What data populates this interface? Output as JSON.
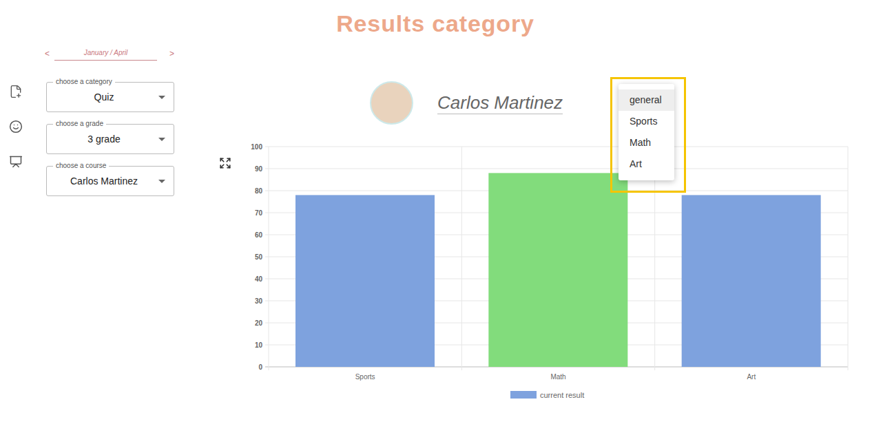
{
  "title": "Results category",
  "period": {
    "prev": "<",
    "label": "January / April",
    "next": ">"
  },
  "filters": [
    {
      "label": "choose a category",
      "value": "Quiz"
    },
    {
      "label": "choose a grade",
      "value": "3 grade"
    },
    {
      "label": "choose a course",
      "value": "Carlos Martinez"
    }
  ],
  "student": {
    "name": "Carlos Martinez"
  },
  "menu": {
    "items": [
      {
        "label": "general",
        "selected": true
      },
      {
        "label": "Sports",
        "selected": false
      },
      {
        "label": "Math",
        "selected": false
      },
      {
        "label": "Art",
        "selected": false
      }
    ]
  },
  "chart": {
    "y_ticks": [
      "0",
      "10",
      "20",
      "30",
      "40",
      "50",
      "60",
      "70",
      "80",
      "90",
      "100"
    ],
    "categories": [
      "Sports",
      "Math",
      "Art"
    ],
    "series": [
      {
        "label": "current result",
        "values": [
          78,
          88,
          78
        ],
        "colors": [
          "#7ea2de",
          "#82dc7c",
          "#7ea2de"
        ],
        "legend_color": "#7ea2de"
      }
    ]
  }
}
